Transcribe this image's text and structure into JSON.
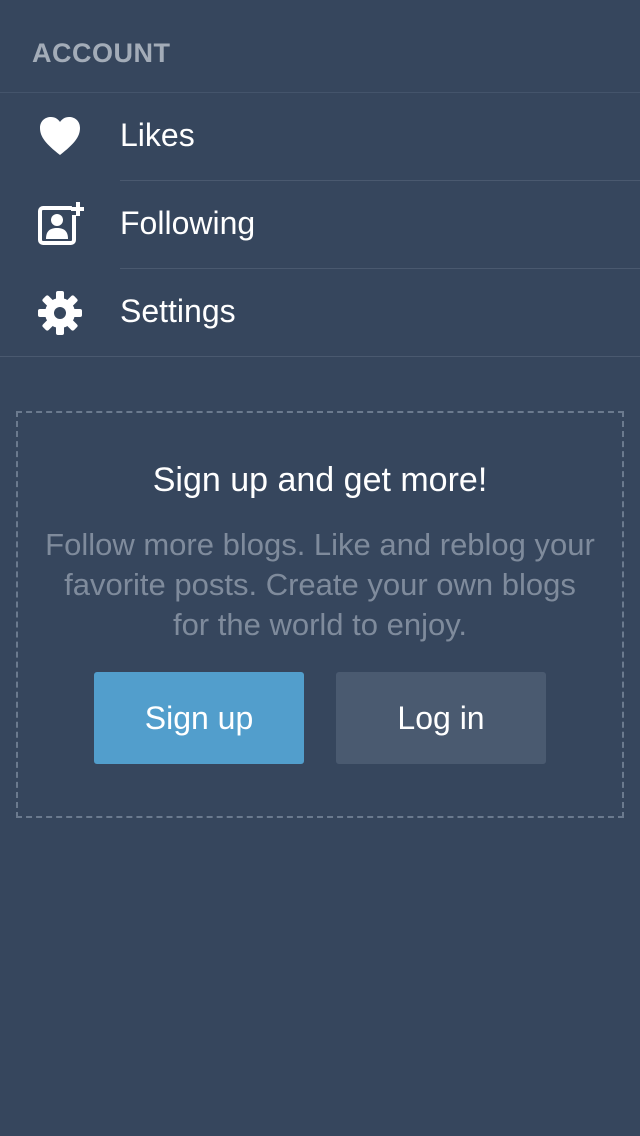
{
  "section": {
    "header": "ACCOUNT"
  },
  "menu": {
    "items": [
      {
        "label": "Likes",
        "icon": "heart-icon"
      },
      {
        "label": "Following",
        "icon": "person-add-icon"
      },
      {
        "label": "Settings",
        "icon": "gear-icon"
      }
    ]
  },
  "promo": {
    "title": "Sign up and get more!",
    "body": "Follow more blogs. Like and reblog your favorite posts. Create your own blogs for the world to enjoy.",
    "signup_label": "Sign up",
    "login_label": "Log in"
  },
  "colors": {
    "background": "#36465d",
    "signup_button": "#529ecc",
    "login_button": "#4a5a70",
    "muted_text": "#7f8b9c"
  }
}
